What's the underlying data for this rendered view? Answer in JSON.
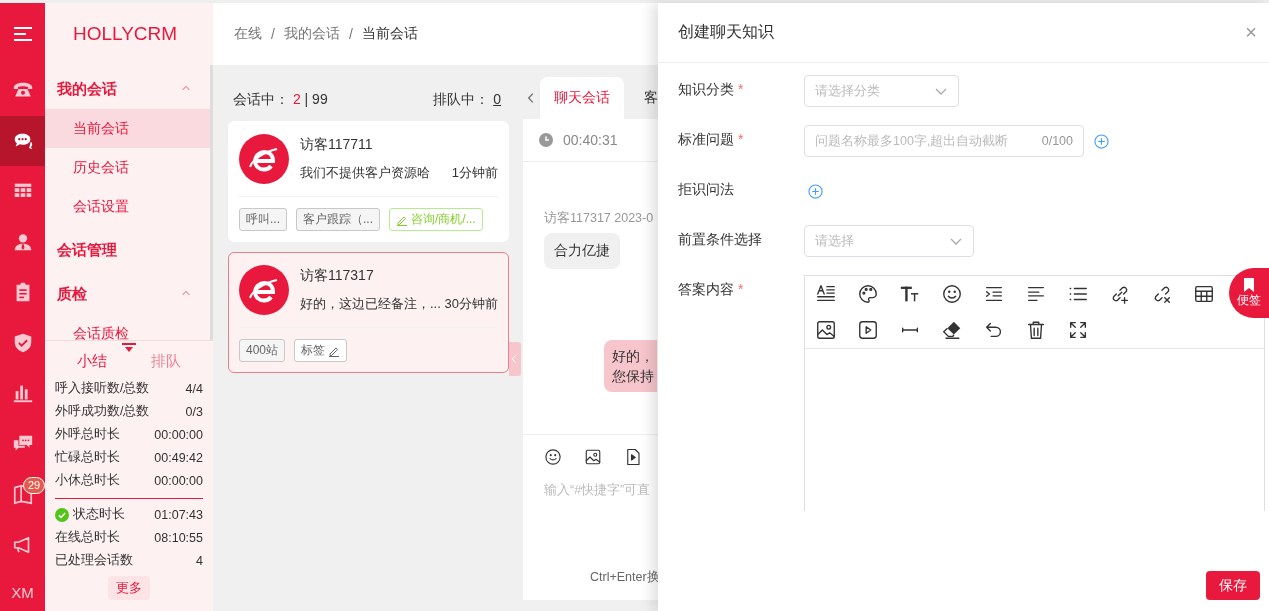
{
  "brand": "HOLLYCRM",
  "rail": {
    "items": [
      {
        "selected": false
      },
      {
        "selected": true
      },
      {
        "selected": false
      },
      {
        "selected": false
      },
      {
        "selected": false
      },
      {
        "selected": false
      },
      {
        "selected": false
      },
      {
        "selected": false
      },
      {
        "selected": false,
        "badge": "29"
      },
      {
        "selected": false
      }
    ],
    "user": "XM"
  },
  "menu": [
    {
      "label": "我的会话",
      "expanded": true,
      "children": [
        {
          "label": "当前会话",
          "selected": true
        },
        {
          "label": "历史会话",
          "selected": false
        },
        {
          "label": "会话设置",
          "selected": false
        }
      ]
    },
    {
      "label": "会话管理"
    },
    {
      "label": "质检",
      "expanded": true,
      "children": [
        {
          "label": "会话质检",
          "selected": false
        }
      ]
    }
  ],
  "summary": {
    "tabs": [
      {
        "label": "小结",
        "selected": true
      },
      {
        "label": "排队",
        "selected": false
      }
    ],
    "stats": [
      {
        "label": "呼入接听数/总数",
        "value": "4/4"
      },
      {
        "label": "外呼成功数/总数",
        "value": "0/3"
      },
      {
        "label": "外呼总时长",
        "value": "00:00:00"
      },
      {
        "label": "忙碌总时长",
        "value": "00:49:42"
      },
      {
        "label": "小休总时长",
        "value": "00:00:00"
      }
    ],
    "status": [
      {
        "label": "状态时长",
        "value": "01:07:43",
        "kind": "status"
      },
      {
        "label": "在线总时长",
        "value": "08:10:55",
        "kind": "plain"
      },
      {
        "label": "已处理会话数",
        "value": "4",
        "kind": "plain"
      }
    ],
    "more": "更多"
  },
  "breadcrumb": [
    {
      "label": "在线",
      "kind": "link"
    },
    {
      "label": "/",
      "kind": "separator"
    },
    {
      "label": "我的会话",
      "kind": "link"
    },
    {
      "label": "/",
      "kind": "separator"
    },
    {
      "label": "当前会话",
      "kind": "current"
    }
  ],
  "sessions": {
    "active_label": "会话中：",
    "active": "2",
    "capacity": "| 99",
    "queue_label": "排队中：",
    "queue": "0",
    "cards": [
      {
        "name": "访客117711",
        "message": "我们不提供客户资源哈",
        "time": "1分钟前",
        "selected": false,
        "tags": [
          {
            "label": "呼叫...",
            "kind": "plain"
          },
          {
            "label": "客户跟踪（...",
            "kind": "plain"
          },
          {
            "label": "咨询/商机/...",
            "kind": "category"
          }
        ]
      },
      {
        "name": "访客117317",
        "message": "好的，这边已经备注，...",
        "time": "30分钟前",
        "selected": true,
        "tags": [
          {
            "label": "400站",
            "kind": "plain"
          },
          {
            "label": "标签",
            "kind": "edit"
          }
        ]
      }
    ]
  },
  "chat": {
    "tabs": [
      {
        "label": "聊天会话",
        "selected": true
      },
      {
        "label": "客",
        "selected": false
      }
    ],
    "timer": "00:40:31",
    "messages": [
      {
        "kind": "incoming",
        "meta": "访客117317 2023-0",
        "text": "合力亿捷"
      },
      {
        "kind": "outgoing",
        "text": "好的，您保持"
      }
    ],
    "input_placeholder": "输入“#快捷字”可直",
    "hint": "Ctrl+Enter换"
  },
  "drawer": {
    "title": "创建聊天知识",
    "close": "×",
    "fields": [
      {
        "label": "知识分类",
        "required_mark": "*",
        "kind": "select",
        "placeholder": "请选择分类"
      },
      {
        "label": "标准问题",
        "required_mark": "*",
        "kind": "text",
        "placeholder": "问题名称最多100字,超出自动截断",
        "counter": "0/100"
      },
      {
        "label": "拒识问法",
        "kind": "add"
      },
      {
        "label": "前置条件选择",
        "kind": "select",
        "placeholder": "请选择"
      },
      {
        "label": "答案内容",
        "required_mark": "*",
        "kind": "editor"
      }
    ],
    "note": "便签",
    "save": "保存"
  }
}
